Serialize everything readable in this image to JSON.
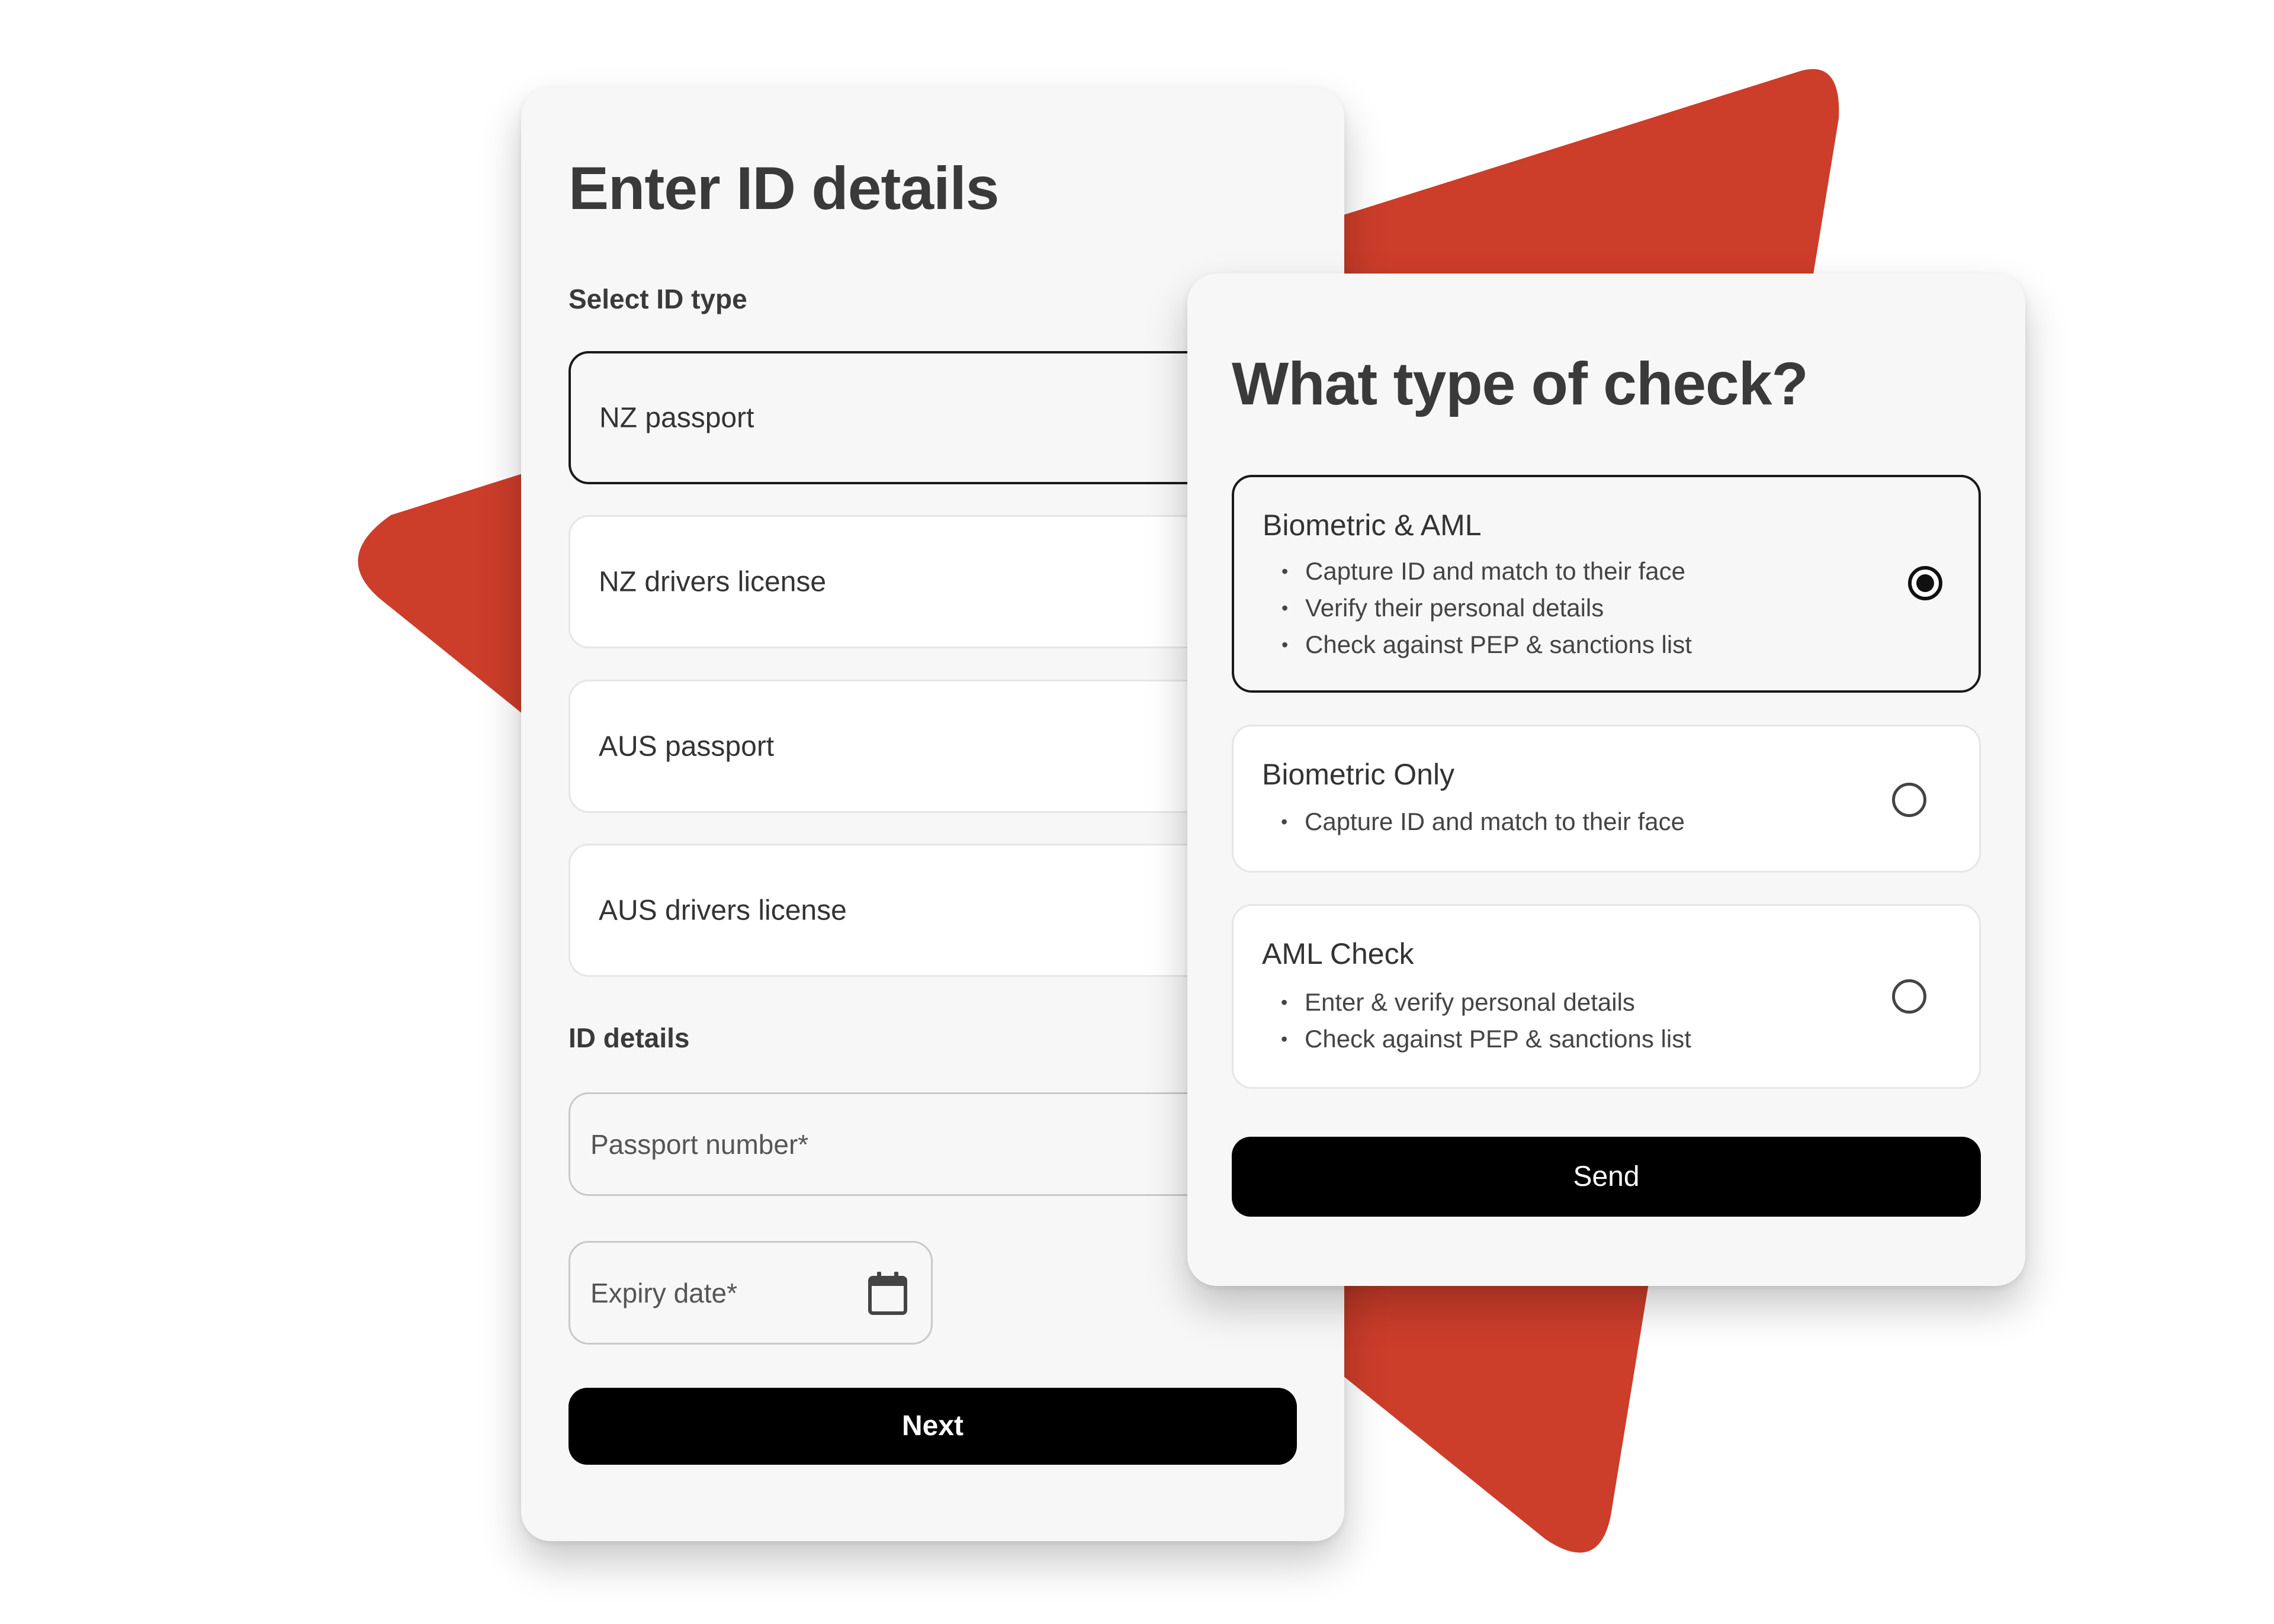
{
  "colors": {
    "accent": "#CC3D2A",
    "card_background": "#F7F7F7",
    "button_background": "#000000",
    "button_text": "#FFFFFF"
  },
  "id_card": {
    "title": "Enter ID details",
    "select_label": "Select ID type",
    "id_types": [
      {
        "label": "NZ passport",
        "selected": true
      },
      {
        "label": "NZ drivers license",
        "selected": false
      },
      {
        "label": "AUS passport",
        "selected": false
      },
      {
        "label": "AUS drivers license",
        "selected": false
      }
    ],
    "details_label": "ID details",
    "passport_number": {
      "placeholder": "Passport number*",
      "value": ""
    },
    "expiry_date": {
      "placeholder": "Expiry date*",
      "value": "",
      "icon": "calendar-icon"
    },
    "next_button": "Next"
  },
  "check_card": {
    "title": "What type of check?",
    "options": [
      {
        "title": "Biometric & AML",
        "bullets": [
          "Capture ID and match to their face",
          "Verify their personal details",
          "Check against PEP & sanctions list"
        ],
        "selected": true
      },
      {
        "title": "Biometric Only",
        "bullets": [
          "Capture ID and match to their face"
        ],
        "selected": false
      },
      {
        "title": "AML Check",
        "bullets": [
          "Enter & verify personal details",
          "Check against PEP & sanctions list"
        ],
        "selected": false
      }
    ],
    "send_button": "Send"
  }
}
